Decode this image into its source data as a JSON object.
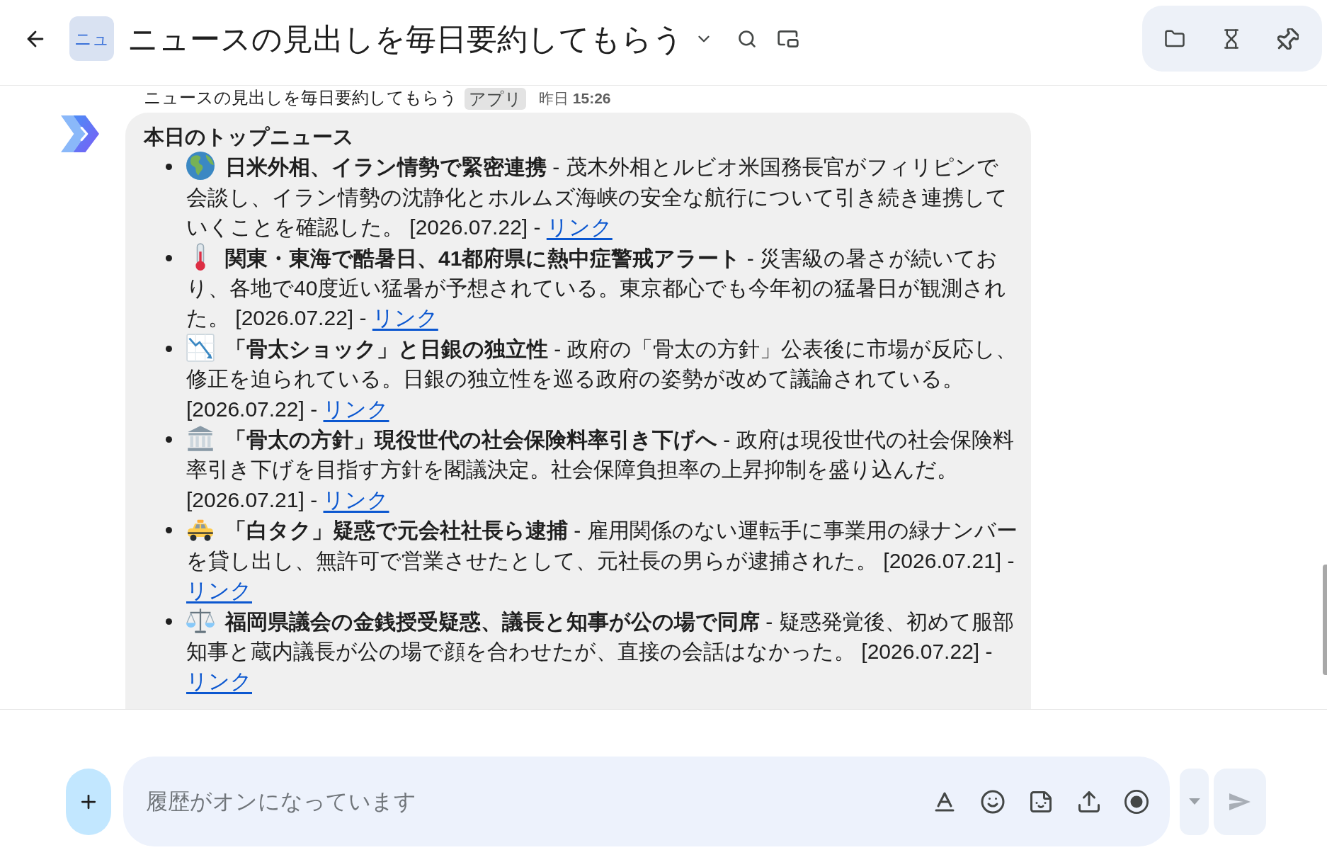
{
  "header": {
    "avatar_text": "ニュ",
    "title": "ニュースの見出しを毎日要約してもらう"
  },
  "message": {
    "sender": "ニュースの見出しを毎日要約してもらう",
    "badge": "アプリ",
    "timestamp": "昨日 **15:26**",
    "heading": "本日のトップニュース",
    "items": [
      {
        "text": "**日米外相、イラン情勢で緊密連携** - 茂木外相とルビオ米国務長官がフィリピンで会談し、イラン情勢の沈静化とホルムズ海峡の安全な航行について引き続き連携していくことを確認した。 [2026.07.22] - ",
        "link": "リンク"
      },
      {
        "text": "**関東・東海で酷暑日、41都府県に熱中症警戒アラート** - 災害級の暑さが続いており、各地で40度近い猛暑が予想されている。東京都心でも今年初の猛暑日が観測された。 [2026.07.22] - ",
        "link": "リンク"
      },
      {
        "text": "**「骨太ショック」と日銀の独立性** - 政府の「骨太の方針」公表後に市場が反応し、修正を迫られている。日銀の独立性を巡る政府の姿勢が改めて議論されている。 [2026.07.22] - ",
        "link": "リンク"
      },
      {
        "text": "**「骨太の方針」現役世代の社会保険料率引き下げへ** - 政府は現役世代の社会保険料率引き下げを目指す方針を閣議決定。社会保障負担率の上昇抑制を盛り込んだ。 [2026.07.21] - ",
        "link": "リンク"
      },
      {
        "text": "**「白タク」疑惑で元会社社長ら逮捕** - 雇用関係のない運転手に事業用の緑ナンバーを貸し出し、無許可で営業させたとして、元社長の男らが逮捕された。 [2026.07.21] - ",
        "link": "リンク"
      },
      {
        "text": "**福岡県議会の金銭授受疑惑、議長と知事が公の場で同席** - 疑惑発覚後、初めて服部知事と蔵内議長が公の場で顔を合わせたが、直接の会話はなかった。 [2026.07.22] - ",
        "link": "リンク"
      }
    ]
  },
  "composer": {
    "placeholder": "履歴がオンになっています",
    "send_disabled": true
  }
}
